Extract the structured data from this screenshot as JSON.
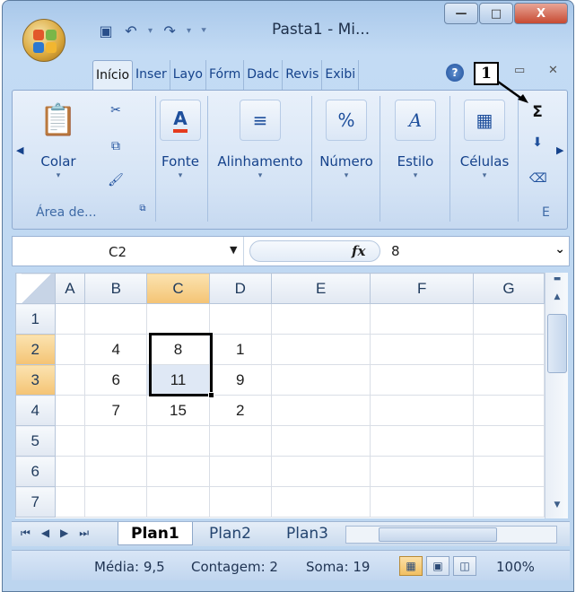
{
  "window": {
    "title": "Pasta1 - Mi...",
    "controls": {
      "minimize": "—",
      "maximize": "□",
      "close": "X"
    }
  },
  "ribbon_tabs": [
    "Início",
    "Inser",
    "Layo",
    "Fórm",
    "Dadc",
    "Revis",
    "Exibi"
  ],
  "callout_label": "1",
  "ribbon": {
    "groups": {
      "clipboard": {
        "button": "Colar",
        "label": "Área de..."
      },
      "font": {
        "button": "Fonte"
      },
      "alignment": {
        "button": "Alinhamento"
      },
      "number": {
        "button": "Número",
        "icon_text": "%"
      },
      "style": {
        "button": "Estilo"
      },
      "cells": {
        "button": "Células"
      },
      "editing": {
        "sum_icon": "Σ",
        "label": "E"
      }
    }
  },
  "formula_bar": {
    "name_box": "C2",
    "fx": "fx",
    "value": "8"
  },
  "grid": {
    "columns": [
      "A",
      "B",
      "C",
      "D",
      "E",
      "F",
      "G"
    ],
    "rows": [
      {
        "num": "1",
        "cells": [
          "",
          "",
          "",
          "",
          "",
          "",
          ""
        ]
      },
      {
        "num": "2",
        "cells": [
          "",
          "4",
          "8",
          "1",
          "",
          "",
          ""
        ]
      },
      {
        "num": "3",
        "cells": [
          "",
          "6",
          "11",
          "9",
          "",
          "",
          ""
        ]
      },
      {
        "num": "4",
        "cells": [
          "",
          "7",
          "15",
          "2",
          "",
          "",
          ""
        ]
      },
      {
        "num": "5",
        "cells": [
          "",
          "",
          "",
          "",
          "",
          "",
          ""
        ]
      },
      {
        "num": "6",
        "cells": [
          "",
          "",
          "",
          "",
          "",
          "",
          ""
        ]
      },
      {
        "num": "7",
        "cells": [
          "",
          "",
          "",
          "",
          "",
          "",
          ""
        ]
      }
    ],
    "selected_range": "C2:C3"
  },
  "sheet_tabs": [
    "Plan1",
    "Plan2",
    "Plan3"
  ],
  "active_sheet": "Plan1",
  "status": {
    "average": "Média: 9,5",
    "count": "Contagem: 2",
    "sum": "Soma: 19",
    "zoom": "100%"
  },
  "colors": {
    "selection_header": "#f4c374",
    "ribbon_bg": "#d4e3f5",
    "accent_text": "#15428b"
  }
}
